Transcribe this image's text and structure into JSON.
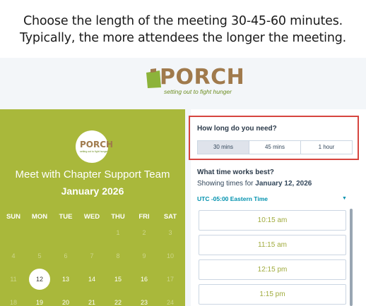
{
  "caption": {
    "line1": "Choose the length of the meeting 30-45-60 minutes.",
    "line2": "Typically, the more attendees the longer the meeting."
  },
  "logo": {
    "word": "PORCH",
    "tagline": "setting out to fight hunger",
    "icon": "porch-bag-icon"
  },
  "calendar": {
    "title": "Meet with Chapter Support Team",
    "month": "January 2026",
    "weekdays": [
      "SUN",
      "MON",
      "TUE",
      "WED",
      "THU",
      "FRI",
      "SAT"
    ],
    "row1": [
      "",
      "",
      "",
      "",
      "1",
      "2",
      "3"
    ],
    "row2": [
      "4",
      "5",
      "6",
      "7",
      "8",
      "9",
      "10"
    ],
    "row3": [
      "11",
      "12",
      "13",
      "14",
      "15",
      "16",
      "17"
    ],
    "row4": [
      "18",
      "19",
      "20",
      "21",
      "22",
      "23",
      "24"
    ],
    "selected_day": "12",
    "colors": {
      "background": "#a9b83b",
      "muted_day": "#cdd68a"
    }
  },
  "duration": {
    "question": "How long do you need?",
    "options": [
      "30 mins",
      "45 mins",
      "1 hour"
    ],
    "selected": "30 mins",
    "highlight_color": "#d6453f"
  },
  "times": {
    "question": "What time works best?",
    "showing_prefix": "Showing times for",
    "showing_date": "January 12, 2026",
    "timezone": "UTC -05:00 Eastern Time",
    "slots": [
      "10:15 am",
      "11:15 am",
      "12:15 pm",
      "1:15 pm"
    ],
    "accent": "#0091ae",
    "slot_color": "#a0ab3d"
  }
}
